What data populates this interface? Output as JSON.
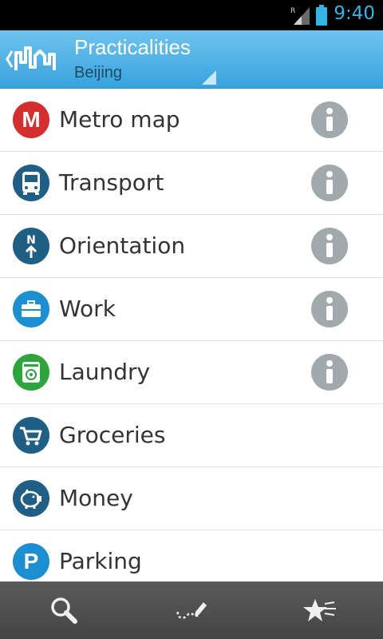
{
  "status_bar": {
    "time": "9:40",
    "signal_label": "R"
  },
  "action_bar": {
    "title": "Practicalities",
    "subtitle": "Beijing",
    "back_icon": "chevron-left-icon",
    "logo_icon": "city-logo-icon"
  },
  "list": {
    "items": [
      {
        "label": "Metro map",
        "icon": "metro-icon",
        "icon_text": "M",
        "color": "#d62e2e",
        "info": true
      },
      {
        "label": "Transport",
        "icon": "bus-icon",
        "color": "#1f5f86",
        "info": true
      },
      {
        "label": "Orientation",
        "icon": "compass-north-icon",
        "icon_text": "N",
        "color": "#1f5f86",
        "info": true
      },
      {
        "label": "Work",
        "icon": "briefcase-icon",
        "color": "#1c8fd0",
        "info": true
      },
      {
        "label": "Laundry",
        "icon": "washing-machine-icon",
        "color": "#2ea43d",
        "info": true
      },
      {
        "label": "Groceries",
        "icon": "shopping-cart-icon",
        "color": "#1f5f86",
        "info": false
      },
      {
        "label": "Money",
        "icon": "piggy-bank-icon",
        "color": "#1f5f86",
        "info": false
      },
      {
        "label": "Parking",
        "icon": "parking-icon",
        "icon_text": "P",
        "color": "#1c8fd0",
        "info": false
      }
    ],
    "info_icon": "info-icon"
  },
  "bottom_bar": {
    "items": [
      "search-icon",
      "route-edit-icon",
      "favorites-icon"
    ]
  },
  "colors": {
    "accent": "#33b5e5",
    "action_bar": "#4cb2e6",
    "info_gray": "#a2a9ad"
  }
}
